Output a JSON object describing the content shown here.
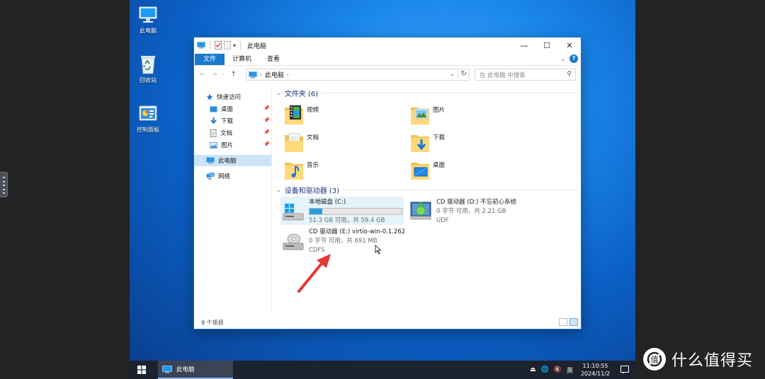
{
  "desktop": {
    "icons": [
      {
        "label": "此电脑",
        "icon": "computer-icon"
      },
      {
        "label": "回收站",
        "icon": "recycle-bin-icon"
      },
      {
        "label": "控制面板",
        "icon": "control-panel-icon"
      }
    ]
  },
  "window": {
    "title": "此电脑",
    "tabs": [
      "文件",
      "计算机",
      "查看"
    ],
    "address": {
      "path": [
        "此电脑"
      ]
    },
    "search": {
      "placeholder": "在 此电脑 中搜索"
    },
    "nav_pane": {
      "quick_access": "快速访问",
      "items": [
        {
          "label": "桌面",
          "icon": "desktop-icon",
          "pinned": true
        },
        {
          "label": "下载",
          "icon": "download-icon",
          "pinned": true
        },
        {
          "label": "文档",
          "icon": "document-icon",
          "pinned": true
        },
        {
          "label": "图片",
          "icon": "picture-icon",
          "pinned": true
        }
      ],
      "this_pc": "此电脑",
      "network": "网络"
    },
    "folders_group": {
      "title": "文件夹 (6)",
      "items": [
        "视频",
        "图片",
        "文档",
        "下载",
        "音乐",
        "桌面"
      ]
    },
    "drives_group": {
      "title": "设备和驱动器 (3)",
      "drives": [
        {
          "name": "本地磁盘 (C:)",
          "detail": "51.3 GB 可用，共 59.4 GB",
          "used_fraction": 0.136
        },
        {
          "name": "CD 驱动器 (D:) 不忘初心系统",
          "detail": "0 字节 可用，共 2.21 GB",
          "fs": "UDF"
        },
        {
          "name": "CD 驱动器 (E:) virtio-win-0.1.262",
          "detail": "0 字节 可用，共 691 MB",
          "fs": "CDFS"
        }
      ]
    },
    "status": "9 个项目"
  },
  "taskbar": {
    "app_label": "此电脑",
    "ime": "英",
    "time": "11:10:55",
    "date": "2024/11/2"
  },
  "watermark": "什么值得买",
  "colors": {
    "accent": "#1979ca",
    "arrow": "#e53935",
    "desktop": "#0b6fd8"
  }
}
